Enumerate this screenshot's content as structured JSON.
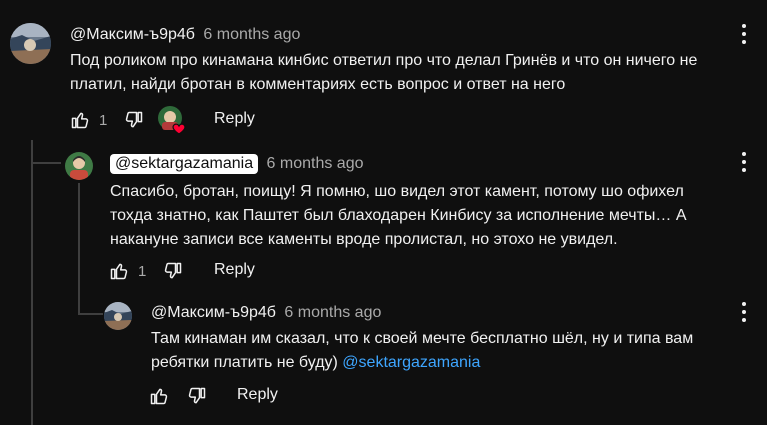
{
  "comments": [
    {
      "author": "@Максим-ъ9р4б",
      "time": "6 months ago",
      "text_lines": [
        "Под роликом про кинамана кинбис ответил про что делал Гринёв и что он ничего не",
        "платил, найди бротан в комментариях есть вопрос и ответ на него"
      ],
      "likes": "1",
      "reply_label": "Reply"
    },
    {
      "author": "@sektargazamania",
      "time": "6 months ago",
      "text_lines": [
        "Спасибо, бротан, поищу! Я помню, шо видел этот камент, потому шо офихел",
        "тохда знатно, как Паштет был блаходарен Кинбису за исполнение мечты… А",
        "накануне записи все каменты вроде пролистал, но этохо не увидел."
      ],
      "likes": "1",
      "reply_label": "Reply"
    },
    {
      "author": "@Максим-ъ9р4б",
      "time": "6 months ago",
      "text_lines": [
        "Там кинаман им сказал, что к своей мечте бесплатно шёл, ну и типа вам"
      ],
      "text_last_prefix": "ребятки платить не буду) ",
      "mention": "@sektargazamania",
      "reply_label": "Reply"
    }
  ],
  "colors": {
    "background": "#0f0f0f",
    "text": "#f1f1f1",
    "secondary": "#aaaaaa",
    "mention": "#3ea6ff",
    "heart": "#ff0033"
  },
  "icons": [
    "thumb-up-icon",
    "thumb-down-icon",
    "more-vert-icon",
    "creator-heart-icon"
  ]
}
